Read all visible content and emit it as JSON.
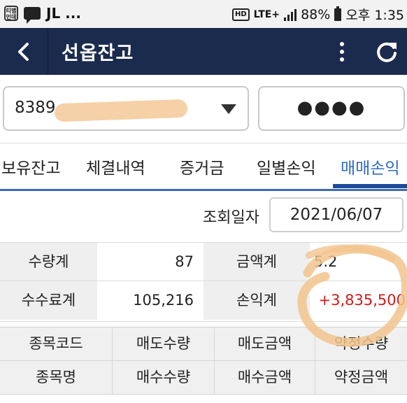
{
  "status_bar": {
    "badge_text": "티맵\n인데",
    "app_text": "JL ...",
    "network": "LTE+",
    "battery": "88%",
    "time": "오후 1:35"
  },
  "header": {
    "title": "선옵잔고"
  },
  "account": {
    "number_visible": "8389",
    "password_masked": "●●●●"
  },
  "tabs": [
    {
      "label": "보유잔고"
    },
    {
      "label": "체결내역"
    },
    {
      "label": "증거금"
    },
    {
      "label": "일별손익"
    },
    {
      "label": "매매손익"
    }
  ],
  "query": {
    "label": "조회일자",
    "date": "2021/06/07"
  },
  "summary": {
    "qty_label": "수량계",
    "qty_value": "87",
    "amount_label": "금액계",
    "amount_value": "5.2",
    "fee_label": "수수료계",
    "fee_value": "105,216",
    "pnl_label": "손익계",
    "pnl_value": "+3,835,500"
  },
  "detail_headers": {
    "row1": [
      "종목코드",
      "매도수량",
      "매도금액",
      "약정수량"
    ],
    "row2": [
      "종목명",
      "매수수량",
      "매수금액",
      "약정금액"
    ]
  },
  "colors": {
    "header_bg": "#1b2b4e",
    "accent_blue": "#2f6ac2",
    "profit_red": "#d01a1a"
  }
}
